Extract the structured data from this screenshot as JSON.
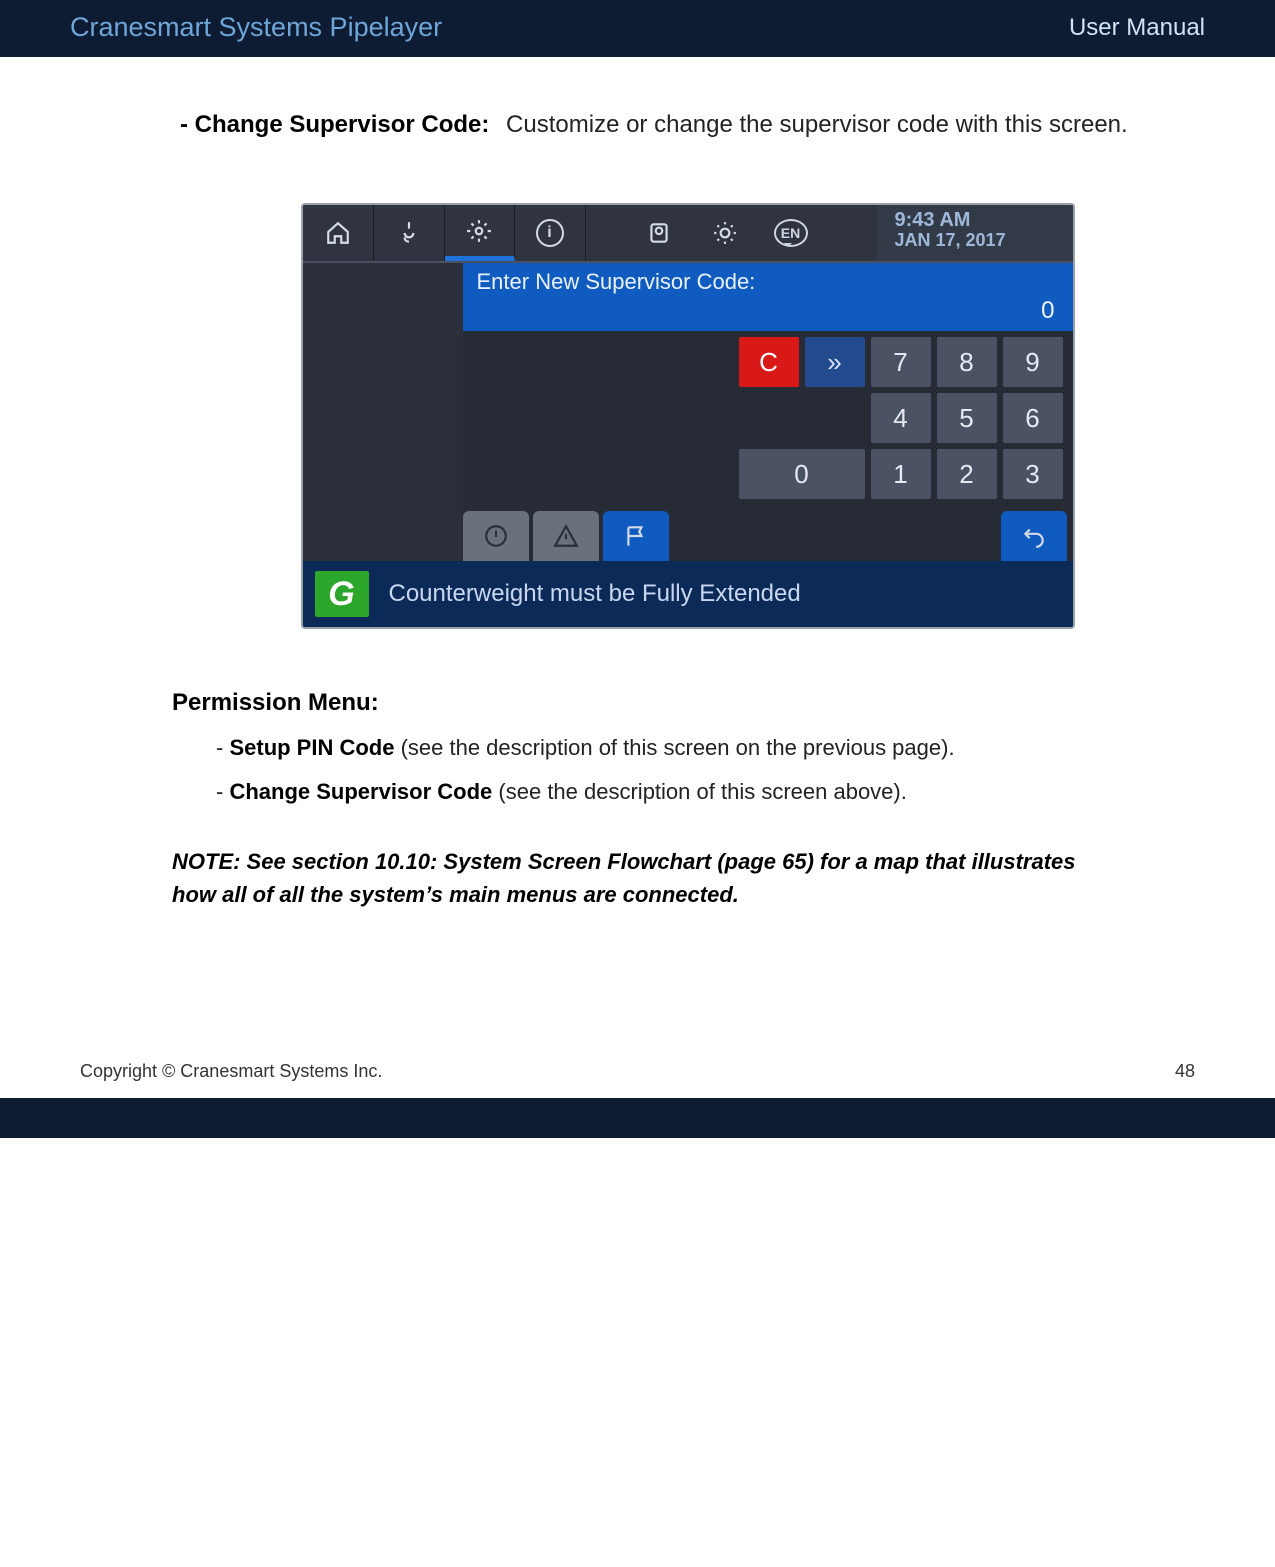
{
  "header": {
    "left": "Cranesmart Systems Pipelayer",
    "right": "User Manual"
  },
  "intro": {
    "lead": "- Change Supervisor Code:",
    "rest": "Customize or change the supervisor code with this screen."
  },
  "device": {
    "clock_time": "9:43 AM",
    "clock_date": "JAN 17, 2017",
    "prompt": "Enter New Supervisor Code:",
    "prompt_value": "0",
    "keys": {
      "clear": "C",
      "go": "»",
      "k7": "7",
      "k8": "8",
      "k9": "9",
      "k4": "4",
      "k5": "5",
      "k6": "6",
      "k0": "0",
      "k1": "1",
      "k2": "2",
      "k3": "3"
    },
    "lang": "EN",
    "back": "↶",
    "status_icon": "G",
    "status_msg": "Counterweight must be Fully Extended"
  },
  "permission": {
    "heading": "Permission Menu:",
    "item1_bold": "Setup PIN Code",
    "item1_rest": " (see the description of this screen on the previous page).",
    "item2_bold": "Change Supervisor Code",
    "item2_rest": " (see the description of this screen above)."
  },
  "note": "NOTE: See section 10.10: System Screen Flowchart (page 65) for a map that illustrates how all of all the system’s main menus are connected.",
  "footer": {
    "left": "Copyright © Cranesmart Systems Inc.",
    "right": "48"
  }
}
